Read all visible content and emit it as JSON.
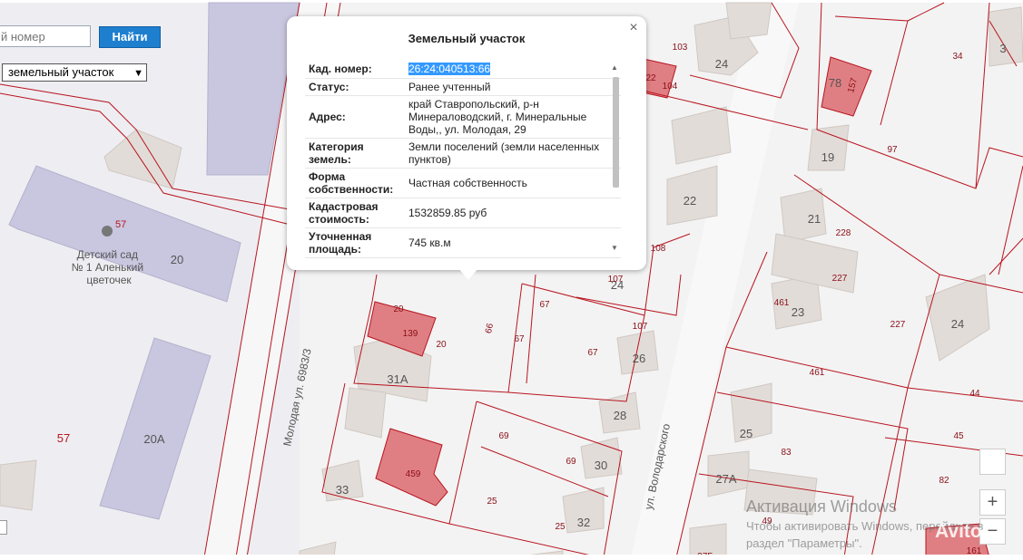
{
  "search": {
    "placeholder": "й номер",
    "button_label": "Найти"
  },
  "layer_select": {
    "selected": "земельный участок"
  },
  "popup": {
    "title": "Земельный участок",
    "close_glyph": "×",
    "rows": [
      {
        "key": "Кад. номер:",
        "value": "26:24:040513:66"
      },
      {
        "key": "Статус:",
        "value": "Ранее учтенный"
      },
      {
        "key": "Адрес:",
        "value": "край Ставропольский, р-н Минераловодский, г. Минеральные Воды,, ул. Молодая, 29"
      },
      {
        "key": "Категория земель:",
        "value": "Земли поселений (земли населенных пунктов)"
      },
      {
        "key": "Форма собственности:",
        "value": "Частная собственность"
      },
      {
        "key": "Кадастровая стоимость:",
        "value": "1532859.85 руб"
      },
      {
        "key": "Уточненная площадь:",
        "value": "745 кв.м"
      }
    ]
  },
  "map": {
    "streets": [
      "Молодая ул.",
      "ул. Володарского"
    ],
    "poi": {
      "name": "Детский сад № 1 Аленький цветочек",
      "number": "57"
    },
    "building_labels": [
      "20",
      "20А",
      "57",
      "31А",
      "33",
      "28",
      "26",
      "24",
      "30",
      "32",
      "22",
      "25",
      "27А",
      "23",
      "21",
      "19",
      "78",
      "3",
      "24",
      "24"
    ],
    "parcel_labels": [
      "103",
      "104",
      "22",
      "97",
      "34",
      "157",
      "228",
      "227",
      "227",
      "461",
      "461",
      "44",
      "45",
      "82",
      "83",
      "49",
      "108",
      "107",
      "107",
      "67",
      "67",
      "67",
      "66",
      "20",
      "20",
      "139",
      "69",
      "69",
      "459",
      "25",
      "25",
      "161",
      "27Б"
    ]
  },
  "zoom": {
    "plus": "+",
    "minus": "−"
  },
  "watermark": {
    "line1": "Активация Windows",
    "line2": "Чтобы активировать Windows, перейдите в",
    "line3": "раздел \"Параметры\".",
    "avito": "Avito"
  },
  "colors": {
    "parcel_border": "#b8141f",
    "highlight_parcel": "#e07f83",
    "building": "#e2dcd8",
    "poi_building": "#c9c6df",
    "search_button": "#1f7fcf"
  }
}
